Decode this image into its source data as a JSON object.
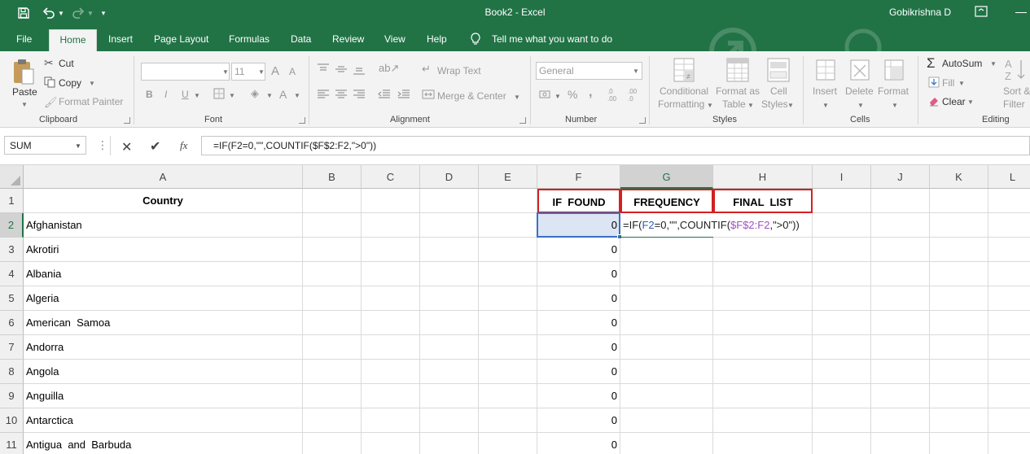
{
  "app": {
    "doc_title": "Book2  -  Excel",
    "user": "Gobikrishna D"
  },
  "tabs": [
    "File",
    "Home",
    "Insert",
    "Page Layout",
    "Formulas",
    "Data",
    "Review",
    "View",
    "Help"
  ],
  "tell_me": "Tell me what you want to do",
  "ribbon": {
    "clipboard": {
      "label": "Clipboard",
      "paste": "Paste",
      "cut": "Cut",
      "copy": "Copy",
      "format_painter": "Format Painter"
    },
    "font": {
      "label": "Font",
      "size": "11",
      "bold": "B",
      "italic": "I",
      "underline": "U",
      "grow": "A",
      "shrink": "A",
      "color": "A"
    },
    "alignment": {
      "label": "Alignment",
      "wrap": "Wrap Text",
      "merge": "Merge & Center"
    },
    "number": {
      "label": "Number",
      "format": "General",
      "percent": "%",
      "comma": ",",
      "inc_dec": ".0 .00",
      "dec_dec": ".00 .0"
    },
    "styles": {
      "label": "Styles",
      "conditional_1": "Conditional",
      "conditional_2": "Formatting",
      "format_table_1": "Format as",
      "format_table_2": "Table",
      "cell_styles_1": "Cell",
      "cell_styles_2": "Styles"
    },
    "cells": {
      "label": "Cells",
      "insert": "Insert",
      "delete": "Delete",
      "format": "Format"
    },
    "editing": {
      "label": "Editing",
      "autosum": "AutoSum",
      "fill": "Fill",
      "clear": "Clear",
      "sort_1": "Sort &",
      "sort_2": "Filter"
    }
  },
  "formula_bar": {
    "name_box": "SUM",
    "formula": "=IF(F2=0,\"\",COUNTIF($F$2:F2,\">0\"))",
    "fx": "fx"
  },
  "grid": {
    "columns": [
      "A",
      "B",
      "C",
      "D",
      "E",
      "F",
      "G",
      "H",
      "I",
      "J",
      "K",
      "L"
    ],
    "rows": [
      "1",
      "2",
      "3",
      "4",
      "5",
      "6",
      "7",
      "8",
      "9",
      "10",
      "11"
    ],
    "headers": {
      "A": "Country",
      "F": "IF  FOUND",
      "G": "FREQUENCY",
      "H": "FINAL  LIST"
    },
    "countries": [
      "Afghanistan",
      "Akrotiri",
      "Albania",
      "Algeria",
      "American  Samoa",
      "Andorra",
      "Angola",
      "Anguilla",
      "Antarctica",
      "Antigua  and  Barbuda"
    ],
    "if_found": [
      "0",
      "0",
      "0",
      "0",
      "0",
      "0",
      "0",
      "0",
      "0",
      "0"
    ],
    "edit_formula": {
      "p1": "=IF(",
      "ref1": "F2",
      "p2": "=0,\"\",COUNTIF(",
      "ref2": "$F$2:F2",
      "p3": ",\">0\"))"
    }
  },
  "colors": {
    "accent": "#217346",
    "header_border": "#d42020",
    "selection": "#dbe5f3"
  }
}
